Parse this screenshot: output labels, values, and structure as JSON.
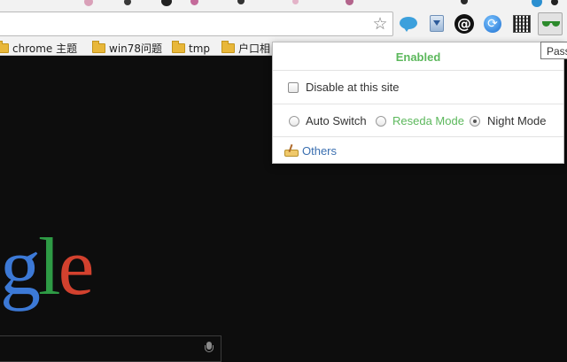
{
  "browser": {
    "tooltip": "Pass",
    "extensions": {
      "speech": "speech-bubble-icon",
      "download": "download-icon",
      "at": "at-sign-icon",
      "sync": "sync-icon",
      "qr": "qr-code-icon",
      "night_eye": "sunglasses-icon"
    },
    "bookmarks": [
      {
        "label": "chrome  主题"
      },
      {
        "label": "win78问题"
      },
      {
        "label": "tmp"
      },
      {
        "label": "户口相"
      }
    ]
  },
  "page": {
    "logo_letters": [
      "g",
      "l",
      "e"
    ],
    "logo_colors": [
      "#3c79d6",
      "#2e9b45",
      "#d2412e"
    ],
    "background": "#0d0d0d"
  },
  "popup": {
    "status": "Enabled",
    "status_color": "#5cb85c",
    "disable_label": "Disable at this site",
    "disable_checked": false,
    "modes": [
      {
        "label": "Auto Switch",
        "selected": false
      },
      {
        "label": "Reseda Mode",
        "selected": false
      },
      {
        "label": "Night Mode",
        "selected": true
      }
    ],
    "others_label": "Others"
  }
}
